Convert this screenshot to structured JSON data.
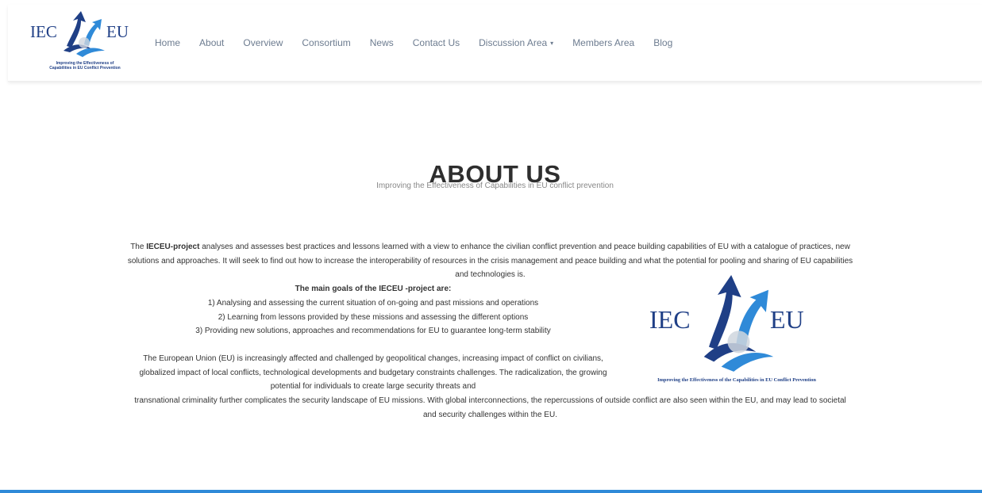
{
  "logo": {
    "text_left": "IEC",
    "text_right": "EU",
    "tagline_line1": "Improving the Effectiveness of",
    "tagline_line2": "Capabilities in EU Conflict Prevention",
    "colors": {
      "navy": "#1f3f86",
      "blue": "#2f8ad8",
      "light_blue": "#5fb6e8"
    }
  },
  "nav": {
    "items": [
      {
        "label": "Home"
      },
      {
        "label": "About"
      },
      {
        "label": "Overview"
      },
      {
        "label": "Consortium"
      },
      {
        "label": "News"
      },
      {
        "label": "Contact Us"
      },
      {
        "label": "Discussion Area",
        "caret": "▾"
      },
      {
        "label": "Members Area"
      },
      {
        "label": "Blog"
      }
    ]
  },
  "hero": {
    "title": "ABOUT US",
    "subtitle": "Improving the Effectiveness of Capabilities in EU conflict prevention"
  },
  "content": {
    "para1_prefix": "The ",
    "para1_bold": "IECEU-project",
    "para1_rest": " analyses and assesses best practices and lessons learned with a view to enhance the civilian conflict prevention and peace building capabilities of EU with a catalogue of practices, new solutions and approaches. It will seek to find out how to increase the interoperability of resources in the crisis management and peace building and what the potential for pooling and sharing of EU capabilities and technologies is.",
    "goals_title": "The main goals of the IECEU -project are:",
    "goals": [
      "1) Analysing and assessing the current situation of on-going and past missions and operations",
      "2) Learning from lessons provided by these missions and assessing the different options",
      "3) Providing new solutions, approaches and recommendations for EU to guarantee long-term stability"
    ],
    "para2a": "The European Union (EU) is increasingly affected and challenged by geopolitical changes, increasing impact of conflict on civilians, globalized impact of local conflicts, technological developments and budgetary constraints challenges. The radicalization, the growing potential for individuals to create large security threats and",
    "para2b": "transnational criminality further complicates the security landscape of EU missions. With global interconnections, the repercussions of outside conflict are also seen within the EU, and may lead to societal and security challenges within the EU."
  },
  "big_logo": {
    "text_left": "IEC",
    "text_right": "EU",
    "tagline": "Improving the Effectiveness of the Capabilities in EU Conflict Prevention"
  },
  "footer": {
    "accent_color": "#2f8ad8"
  }
}
